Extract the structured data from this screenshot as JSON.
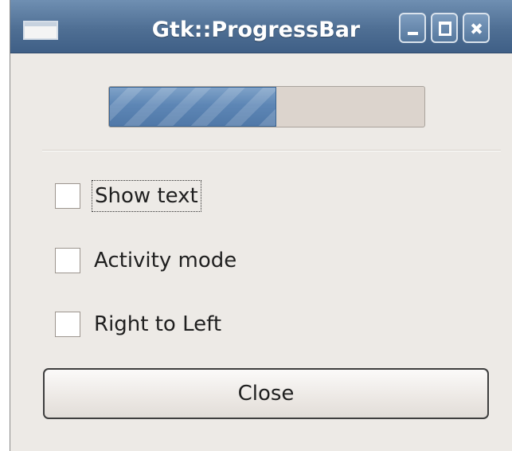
{
  "window": {
    "title": "Gtk::ProgressBar",
    "controls": {
      "minimize_icon": "minimize-icon",
      "maximize_icon": "maximize-icon",
      "close_icon": "close-icon"
    }
  },
  "progress": {
    "fraction": 0.53,
    "fill_color": "#5d86b5"
  },
  "options": [
    {
      "label": "Show text",
      "checked": false
    },
    {
      "label": "Activity mode",
      "checked": false
    },
    {
      "label": "Right to Left",
      "checked": false
    }
  ],
  "close_button": {
    "label": "Close"
  }
}
